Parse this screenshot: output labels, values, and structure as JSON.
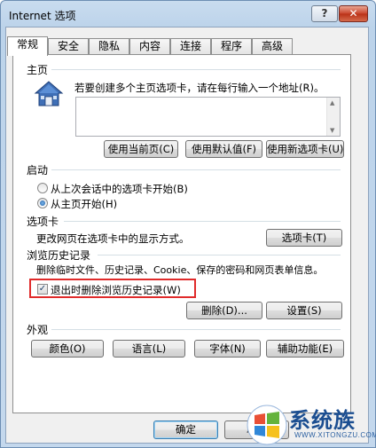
{
  "window": {
    "title": "Internet 选项",
    "help_label": "?",
    "close_label": "✕"
  },
  "tabs": [
    {
      "label": "常规",
      "active": true
    },
    {
      "label": "安全"
    },
    {
      "label": "隐私"
    },
    {
      "label": "内容"
    },
    {
      "label": "连接"
    },
    {
      "label": "程序"
    },
    {
      "label": "高级"
    }
  ],
  "homepage": {
    "title": "主页",
    "description": "若要创建多个主页选项卡，请在每行输入一个地址(R)。",
    "address_value": "",
    "use_current_label": "使用当前页(C)",
    "use_default_label": "使用默认值(F)",
    "use_new_tab_label": "使用新选项卡(U)"
  },
  "startup": {
    "title": "启动",
    "option_last_session": "从上次会话中的选项卡开始(B)",
    "option_homepage": "从主页开始(H)",
    "selected": "option_homepage"
  },
  "tabs_section": {
    "title": "选项卡",
    "description": "更改网页在选项卡中的显示方式。",
    "button_label": "选项卡(T)"
  },
  "history": {
    "title": "浏览历史记录",
    "description": "删除临时文件、历史记录、Cookie、保存的密码和网页表单信息。",
    "checkbox_label": "退出时删除浏览历史记录(W)",
    "checkbox_checked": true,
    "delete_label": "删除(D)...",
    "settings_label": "设置(S)"
  },
  "appearance": {
    "title": "外观",
    "colors_label": "颜色(O)",
    "languages_label": "语言(L)",
    "fonts_label": "字体(N)",
    "accessibility_label": "辅助功能(E)"
  },
  "footer": {
    "ok_label": "确定",
    "cancel_label": "取消"
  },
  "watermark": {
    "brand": "系统族",
    "url": "WWW.XITONGZU.COM"
  },
  "colors": {
    "highlight_box": "#e02b2b",
    "watermark_brand": "#1b4e91"
  }
}
